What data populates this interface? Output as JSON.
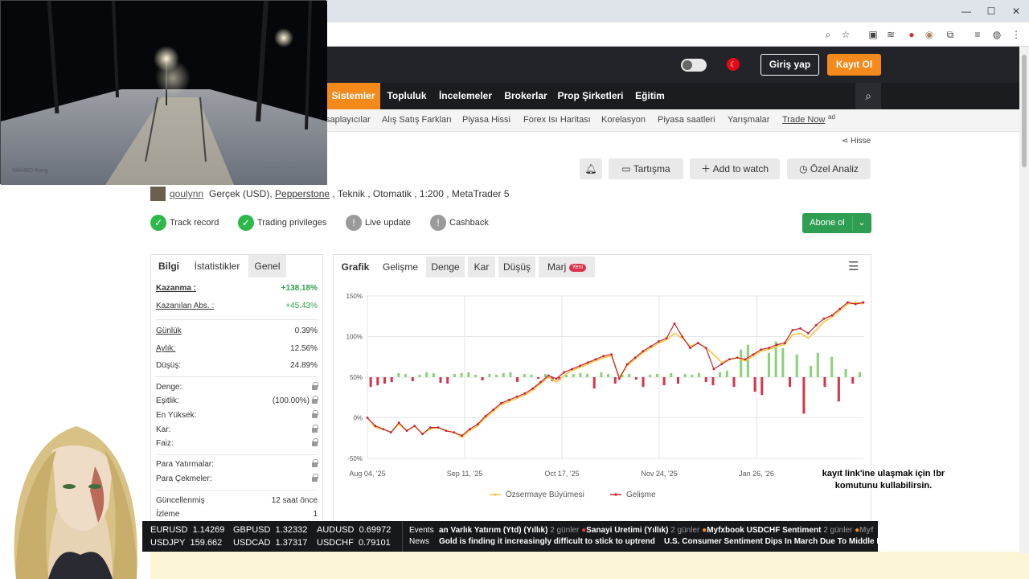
{
  "browser": {
    "minimize_icon": "minimize-icon",
    "maximize_icon": "maximize-icon",
    "close_icon": "close-icon"
  },
  "header": {
    "login_label": "Giriş yap",
    "register_label": "Kayıt Ol",
    "flag_label": "TR"
  },
  "nav": {
    "items": [
      {
        "label": "Sistemler"
      },
      {
        "label": "Topluluk"
      },
      {
        "label": "İncelemeler"
      },
      {
        "label": "Brokerlar"
      },
      {
        "label": "Prop Şirketleri"
      },
      {
        "label": "Eğitim"
      }
    ]
  },
  "subnav": {
    "items": [
      {
        "label": "saplayıcılar"
      },
      {
        "label": "Alış Satış Farkları"
      },
      {
        "label": "Piyasa Hissi"
      },
      {
        "label": "Forex Isı Haritası"
      },
      {
        "label": "Korelasyon"
      },
      {
        "label": "Piyasa saatleri"
      },
      {
        "label": "Yarışmalar"
      },
      {
        "label": "Trade Now"
      }
    ],
    "ad_label": "ad"
  },
  "system": {
    "share_label": "Hisse",
    "actions": {
      "discussion": "Tartışma",
      "watch": "Add to watch",
      "analysis": "Özel Analiz"
    },
    "username": "qoulynn",
    "account_prefix": "Gerçek (USD), ",
    "broker": "Pepperstone",
    "account_suffix": " , Teknik , Otomatik , 1:200 , MetaTrader 5",
    "badges": [
      {
        "label": "Track record"
      },
      {
        "label": "Trading privileges"
      },
      {
        "label": "Live update"
      },
      {
        "label": "Cashback"
      }
    ],
    "subscribe_label": "Abone ol"
  },
  "stats": {
    "tabs": [
      {
        "label": "Bilgi"
      },
      {
        "label": "İstatistikler"
      },
      {
        "label": "Genel"
      }
    ],
    "gain_label": "Kazanma :",
    "gain_value": "+138.18%",
    "abs_label": "Kazanılan Abs. :",
    "abs_value": "+45.43%",
    "daily_label": "Günlük",
    "daily_value": "0.39%",
    "monthly_label": "Aylık:",
    "monthly_value": "12.56%",
    "dd_label": "Düşüş:",
    "dd_value": "24.89%",
    "balance_label": "Denge:",
    "equity_label": "Eşitlik:",
    "equity_value": "(100.00%)",
    "high_label": "En Yüksek:",
    "profit_label": "Kar:",
    "interest_label": "Faiz:",
    "deposits_label": "Para Yatırmalar:",
    "withdrawals_label": "Para Çekmeler:",
    "updated_label": "Güncellenmiş",
    "updated_value": "12 saat önce",
    "watch_label": "İzleme",
    "watch_value": "1"
  },
  "charttabs": [
    {
      "label": "Grafik"
    },
    {
      "label": "Gelişme"
    },
    {
      "label": "Denge"
    },
    {
      "label": "Kar"
    },
    {
      "label": "Düşüş"
    },
    {
      "label": "Marj"
    }
  ],
  "new_badge": "Yeni",
  "chart_data": {
    "type": "line",
    "xlabel": "",
    "ylabel": "",
    "x_ticks": [
      "Aug 04, '25",
      "Sep 11, '25",
      "Oct 17, '25",
      "Nov 24, '25",
      "Jan 26, '26"
    ],
    "y_ticks": [
      "150%",
      "100%",
      "50%",
      "0%",
      "-50%"
    ],
    "ylim": [
      -50,
      150
    ],
    "series": [
      {
        "name": "Özsermaye Büyümesi",
        "color": "#f5c842",
        "values": [
          0,
          -12,
          -14,
          -18,
          -8,
          -16,
          -10,
          -20,
          -14,
          -12,
          -16,
          -18,
          -24,
          -16,
          -10,
          0,
          8,
          16,
          20,
          24,
          28,
          34,
          42,
          50,
          44,
          52,
          58,
          62,
          66,
          70,
          74,
          76,
          50,
          64,
          72,
          80,
          86,
          92,
          96,
          104,
          98,
          88,
          92,
          86,
          78,
          68,
          72,
          74,
          70,
          76,
          82,
          84,
          88,
          90,
          102,
          104,
          98,
          108,
          118,
          124,
          132,
          140,
          142,
          140
        ]
      },
      {
        "name": "Gelişme",
        "color": "#c8202f",
        "values": [
          0,
          -10,
          -14,
          -18,
          -6,
          -16,
          -10,
          -20,
          -12,
          -12,
          -16,
          -18,
          -22,
          -14,
          -8,
          2,
          10,
          18,
          22,
          26,
          30,
          36,
          44,
          52,
          48,
          56,
          60,
          64,
          68,
          72,
          76,
          78,
          48,
          66,
          74,
          82,
          88,
          94,
          98,
          116,
          100,
          86,
          92,
          86,
          60,
          66,
          72,
          74,
          72,
          78,
          84,
          86,
          90,
          92,
          108,
          110,
          104,
          114,
          122,
          126,
          134,
          142,
          140,
          142
        ]
      }
    ],
    "bars": [
      -12,
      -10,
      -8,
      -6,
      5,
      4,
      -5,
      3,
      6,
      5,
      -7,
      -8,
      4,
      5,
      6,
      3,
      -4,
      4,
      3,
      5,
      6,
      -6,
      4,
      3,
      -2,
      4,
      -5,
      -4,
      3,
      4,
      5,
      4,
      -14,
      6,
      4,
      -8,
      3,
      4,
      -3,
      -12,
      3,
      4,
      -10,
      5,
      -8,
      4,
      3,
      5,
      -6,
      -10,
      6,
      8,
      -12,
      34,
      40,
      -18,
      -22,
      30,
      44,
      36,
      -12,
      28,
      -45,
      14,
      30,
      -12,
      25,
      -30,
      10,
      -8,
      6
    ]
  },
  "legend": {
    "equity_growth": "Özsermaye Büyümesi",
    "growth": "Gelişme"
  },
  "ticker": {
    "quotes": [
      {
        "sym": "EURUSD",
        "val": "1.14269"
      },
      {
        "sym": "GBPUSD",
        "val": "1.32332"
      },
      {
        "sym": "AUDUSD",
        "val": "0.69972"
      },
      {
        "sym": "USDJPY",
        "val": "159.662"
      },
      {
        "sym": "USDCAD",
        "val": "1.37317"
      },
      {
        "sym": "USDCHF",
        "val": "0.79101"
      }
    ],
    "events_label": "Events",
    "news_label": "News",
    "events_text": "an Varlık Yatırım (Ytd) (Yıllık)",
    "events_ago1": "2 günler",
    "events_text2": "Sanayi Üretimi (Yıllık)",
    "events_ago2": "2 günler",
    "events_text3": "Myfxbook USDCHF Sentiment",
    "events_ago3": "2 günler",
    "events_more": "Myf",
    "news_text": "Gold is finding it increasingly difficult to stick to uptrend",
    "news_text2": "U.S. Consumer Sentiment Dips In March Due To Middle East C"
  },
  "overlay": {
    "caption": "kayıt link'ine ulaşmak için !br komutunu kullabilirsin.",
    "webcam_watermark": "WAHBO Kong"
  },
  "colors": {
    "accent": "#f48a1c",
    "green": "#2f9e52",
    "red": "#c8202f"
  }
}
